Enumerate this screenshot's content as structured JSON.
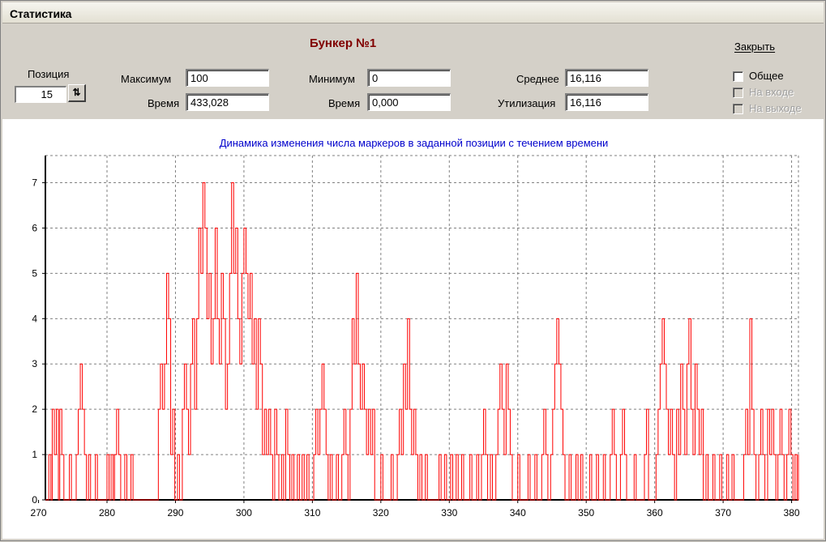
{
  "window": {
    "title": "Статистика"
  },
  "header": {
    "bunker_title": "Бункер №1"
  },
  "position": {
    "label": "Позиция",
    "value": "15"
  },
  "stats": {
    "max_label": "Максимум",
    "max_value": "100",
    "time_label": "Время",
    "max_time_value": "433,028",
    "min_label": "Минимум",
    "min_value": "0",
    "min_time_value": "0,000",
    "avg_label": "Среднее",
    "avg_value": "16,116",
    "util_label": "Утилизация",
    "util_value": "16,116"
  },
  "controls": {
    "close_label": "Закрыть",
    "checkboxes": [
      {
        "label": "Общее",
        "checked": false,
        "enabled": true
      },
      {
        "label": "На входе",
        "checked": false,
        "enabled": false
      },
      {
        "label": "На выходе",
        "checked": false,
        "enabled": false
      }
    ]
  },
  "colors": {
    "line": "#ff0000",
    "heading": "#800000",
    "chart_title": "#0000cc"
  },
  "chart_data": {
    "type": "line",
    "title": "Динамика изменения числа маркеров в заданной позиции с течением времени",
    "xlabel": "",
    "ylabel": "",
    "xlim": [
      271,
      381
    ],
    "ylim": [
      0,
      7.6
    ],
    "xticks": [
      270,
      280,
      290,
      300,
      310,
      320,
      330,
      340,
      350,
      360,
      370,
      380
    ],
    "yticks": [
      0,
      1,
      2,
      3,
      4,
      5,
      6,
      7
    ],
    "grid": true,
    "series": [
      {
        "name": "",
        "step": true,
        "points": [
          [
            271.0,
            0
          ],
          [
            271.5,
            1
          ],
          [
            271.8,
            0
          ],
          [
            272.0,
            2
          ],
          [
            272.3,
            1
          ],
          [
            272.6,
            2
          ],
          [
            272.9,
            0
          ],
          [
            273.1,
            2
          ],
          [
            273.4,
            1
          ],
          [
            273.7,
            0
          ],
          [
            274.5,
            1
          ],
          [
            274.8,
            0
          ],
          [
            275.5,
            1
          ],
          [
            275.8,
            2
          ],
          [
            276.1,
            3
          ],
          [
            276.4,
            2
          ],
          [
            276.7,
            1
          ],
          [
            277.0,
            0
          ],
          [
            277.3,
            1
          ],
          [
            277.6,
            0
          ],
          [
            278.3,
            1
          ],
          [
            278.6,
            0
          ],
          [
            280.0,
            1
          ],
          [
            280.3,
            0
          ],
          [
            280.6,
            1
          ],
          [
            280.9,
            0
          ],
          [
            281.1,
            1
          ],
          [
            281.4,
            2
          ],
          [
            281.7,
            1
          ],
          [
            282.0,
            0
          ],
          [
            282.6,
            1
          ],
          [
            282.9,
            0
          ],
          [
            283.5,
            1
          ],
          [
            283.8,
            0
          ],
          [
            287.5,
            2
          ],
          [
            287.8,
            3
          ],
          [
            288.1,
            2
          ],
          [
            288.4,
            3
          ],
          [
            288.7,
            5
          ],
          [
            289.0,
            4
          ],
          [
            289.3,
            1
          ],
          [
            289.6,
            2
          ],
          [
            289.9,
            0
          ],
          [
            290.3,
            1
          ],
          [
            290.6,
            0
          ],
          [
            291.0,
            2
          ],
          [
            291.3,
            3
          ],
          [
            291.6,
            2
          ],
          [
            291.9,
            1
          ],
          [
            292.2,
            3
          ],
          [
            292.5,
            4
          ],
          [
            292.8,
            2
          ],
          [
            293.1,
            4
          ],
          [
            293.4,
            6
          ],
          [
            293.7,
            5
          ],
          [
            294.0,
            7
          ],
          [
            294.3,
            6
          ],
          [
            294.6,
            4
          ],
          [
            294.9,
            5
          ],
          [
            295.2,
            3
          ],
          [
            295.5,
            4
          ],
          [
            295.8,
            6
          ],
          [
            296.1,
            4
          ],
          [
            296.4,
            3
          ],
          [
            296.7,
            5
          ],
          [
            297.0,
            4
          ],
          [
            297.3,
            2
          ],
          [
            297.6,
            3
          ],
          [
            297.9,
            5
          ],
          [
            298.2,
            7
          ],
          [
            298.5,
            5
          ],
          [
            298.8,
            6
          ],
          [
            299.1,
            4
          ],
          [
            299.4,
            3
          ],
          [
            299.7,
            5
          ],
          [
            300.0,
            6
          ],
          [
            300.3,
            5
          ],
          [
            300.6,
            4
          ],
          [
            300.9,
            5
          ],
          [
            301.2,
            3
          ],
          [
            301.5,
            4
          ],
          [
            301.8,
            2
          ],
          [
            302.1,
            4
          ],
          [
            302.4,
            3
          ],
          [
            302.7,
            1
          ],
          [
            303.0,
            2
          ],
          [
            303.3,
            1
          ],
          [
            303.6,
            2
          ],
          [
            303.9,
            1
          ],
          [
            304.2,
            0
          ],
          [
            304.5,
            2
          ],
          [
            304.8,
            1
          ],
          [
            305.1,
            0
          ],
          [
            305.5,
            1
          ],
          [
            305.8,
            0
          ],
          [
            306.1,
            2
          ],
          [
            306.4,
            1
          ],
          [
            306.7,
            0
          ],
          [
            307.0,
            1
          ],
          [
            307.3,
            0
          ],
          [
            307.8,
            1
          ],
          [
            308.1,
            0
          ],
          [
            308.5,
            1
          ],
          [
            308.8,
            0
          ],
          [
            309.2,
            1
          ],
          [
            309.5,
            0
          ],
          [
            310.2,
            1
          ],
          [
            310.5,
            2
          ],
          [
            310.8,
            1
          ],
          [
            311.1,
            2
          ],
          [
            311.4,
            3
          ],
          [
            311.7,
            2
          ],
          [
            312.0,
            1
          ],
          [
            312.3,
            0
          ],
          [
            312.6,
            1
          ],
          [
            312.9,
            0
          ],
          [
            313.5,
            1
          ],
          [
            313.8,
            0
          ],
          [
            314.3,
            1
          ],
          [
            314.6,
            2
          ],
          [
            314.9,
            1
          ],
          [
            315.2,
            0
          ],
          [
            315.5,
            2
          ],
          [
            315.8,
            4
          ],
          [
            316.1,
            3
          ],
          [
            316.4,
            5
          ],
          [
            316.7,
            3
          ],
          [
            317.0,
            2
          ],
          [
            317.3,
            3
          ],
          [
            317.6,
            2
          ],
          [
            317.9,
            1
          ],
          [
            318.2,
            2
          ],
          [
            318.5,
            1
          ],
          [
            318.8,
            2
          ],
          [
            319.1,
            0
          ],
          [
            320.0,
            1
          ],
          [
            320.3,
            0
          ],
          [
            321.5,
            1
          ],
          [
            321.8,
            0
          ],
          [
            322.4,
            1
          ],
          [
            322.7,
            2
          ],
          [
            323.0,
            1
          ],
          [
            323.3,
            3
          ],
          [
            323.6,
            2
          ],
          [
            323.9,
            4
          ],
          [
            324.2,
            2
          ],
          [
            324.5,
            1
          ],
          [
            324.8,
            2
          ],
          [
            325.1,
            1
          ],
          [
            325.4,
            0
          ],
          [
            325.7,
            1
          ],
          [
            326.0,
            0
          ],
          [
            326.5,
            1
          ],
          [
            326.8,
            0
          ],
          [
            328.5,
            1
          ],
          [
            328.8,
            0
          ],
          [
            329.3,
            1
          ],
          [
            329.6,
            0
          ],
          [
            330.2,
            1
          ],
          [
            330.5,
            0
          ],
          [
            331.0,
            1
          ],
          [
            331.3,
            0
          ],
          [
            331.8,
            1
          ],
          [
            332.1,
            0
          ],
          [
            333.0,
            1
          ],
          [
            333.3,
            0
          ],
          [
            334.0,
            1
          ],
          [
            334.3,
            0
          ],
          [
            334.7,
            1
          ],
          [
            335.0,
            2
          ],
          [
            335.3,
            1
          ],
          [
            335.6,
            0
          ],
          [
            336.0,
            1
          ],
          [
            336.3,
            0
          ],
          [
            336.8,
            1
          ],
          [
            337.1,
            2
          ],
          [
            337.4,
            3
          ],
          [
            337.7,
            2
          ],
          [
            338.0,
            1
          ],
          [
            338.3,
            3
          ],
          [
            338.6,
            2
          ],
          [
            338.9,
            1
          ],
          [
            339.2,
            0
          ],
          [
            340.0,
            1
          ],
          [
            340.3,
            0
          ],
          [
            341.5,
            1
          ],
          [
            341.8,
            0
          ],
          [
            342.5,
            1
          ],
          [
            342.8,
            0
          ],
          [
            343.5,
            1
          ],
          [
            343.8,
            2
          ],
          [
            344.1,
            1
          ],
          [
            344.4,
            0
          ],
          [
            344.8,
            1
          ],
          [
            345.1,
            2
          ],
          [
            345.4,
            3
          ],
          [
            345.7,
            4
          ],
          [
            346.0,
            3
          ],
          [
            346.3,
            2
          ],
          [
            346.6,
            1
          ],
          [
            346.9,
            0
          ],
          [
            347.5,
            1
          ],
          [
            347.8,
            0
          ],
          [
            348.5,
            1
          ],
          [
            348.8,
            0
          ],
          [
            349.2,
            1
          ],
          [
            349.5,
            0
          ],
          [
            350.5,
            1
          ],
          [
            350.8,
            0
          ],
          [
            351.5,
            1
          ],
          [
            351.8,
            0
          ],
          [
            352.5,
            1
          ],
          [
            352.8,
            0
          ],
          [
            353.5,
            1
          ],
          [
            353.8,
            2
          ],
          [
            354.1,
            1
          ],
          [
            354.4,
            0
          ],
          [
            355.0,
            1
          ],
          [
            355.3,
            2
          ],
          [
            355.6,
            1
          ],
          [
            355.9,
            0
          ],
          [
            357.0,
            1
          ],
          [
            357.3,
            0
          ],
          [
            358.5,
            1
          ],
          [
            358.8,
            2
          ],
          [
            359.1,
            0
          ],
          [
            360.2,
            1
          ],
          [
            360.5,
            2
          ],
          [
            360.8,
            3
          ],
          [
            361.1,
            4
          ],
          [
            361.4,
            3
          ],
          [
            361.7,
            2
          ],
          [
            362.0,
            1
          ],
          [
            362.3,
            2
          ],
          [
            362.6,
            1
          ],
          [
            362.9,
            0
          ],
          [
            363.2,
            2
          ],
          [
            363.5,
            1
          ],
          [
            363.8,
            3
          ],
          [
            364.1,
            2
          ],
          [
            364.4,
            1
          ],
          [
            364.7,
            3
          ],
          [
            365.0,
            4
          ],
          [
            365.3,
            2
          ],
          [
            365.6,
            1
          ],
          [
            365.9,
            3
          ],
          [
            366.2,
            2
          ],
          [
            366.5,
            1
          ],
          [
            366.8,
            2
          ],
          [
            367.1,
            0
          ],
          [
            367.5,
            1
          ],
          [
            367.8,
            0
          ],
          [
            368.5,
            1
          ],
          [
            368.8,
            0
          ],
          [
            369.5,
            1
          ],
          [
            369.8,
            0
          ],
          [
            370.5,
            1
          ],
          [
            370.8,
            0
          ],
          [
            371.3,
            1
          ],
          [
            371.6,
            0
          ],
          [
            373.0,
            1
          ],
          [
            373.3,
            2
          ],
          [
            373.6,
            1
          ],
          [
            373.9,
            4
          ],
          [
            374.2,
            2
          ],
          [
            374.5,
            1
          ],
          [
            374.8,
            0
          ],
          [
            375.2,
            1
          ],
          [
            375.5,
            2
          ],
          [
            375.8,
            1
          ],
          [
            376.1,
            0
          ],
          [
            376.5,
            2
          ],
          [
            376.8,
            1
          ],
          [
            377.1,
            2
          ],
          [
            377.4,
            1
          ],
          [
            377.7,
            0
          ],
          [
            378.0,
            1
          ],
          [
            378.3,
            2
          ],
          [
            378.6,
            1
          ],
          [
            378.9,
            0
          ],
          [
            379.3,
            1
          ],
          [
            379.6,
            2
          ],
          [
            379.9,
            1
          ],
          [
            380.2,
            0
          ],
          [
            380.5,
            1
          ],
          [
            380.8,
            0
          ],
          [
            381.0,
            1
          ]
        ]
      }
    ]
  }
}
